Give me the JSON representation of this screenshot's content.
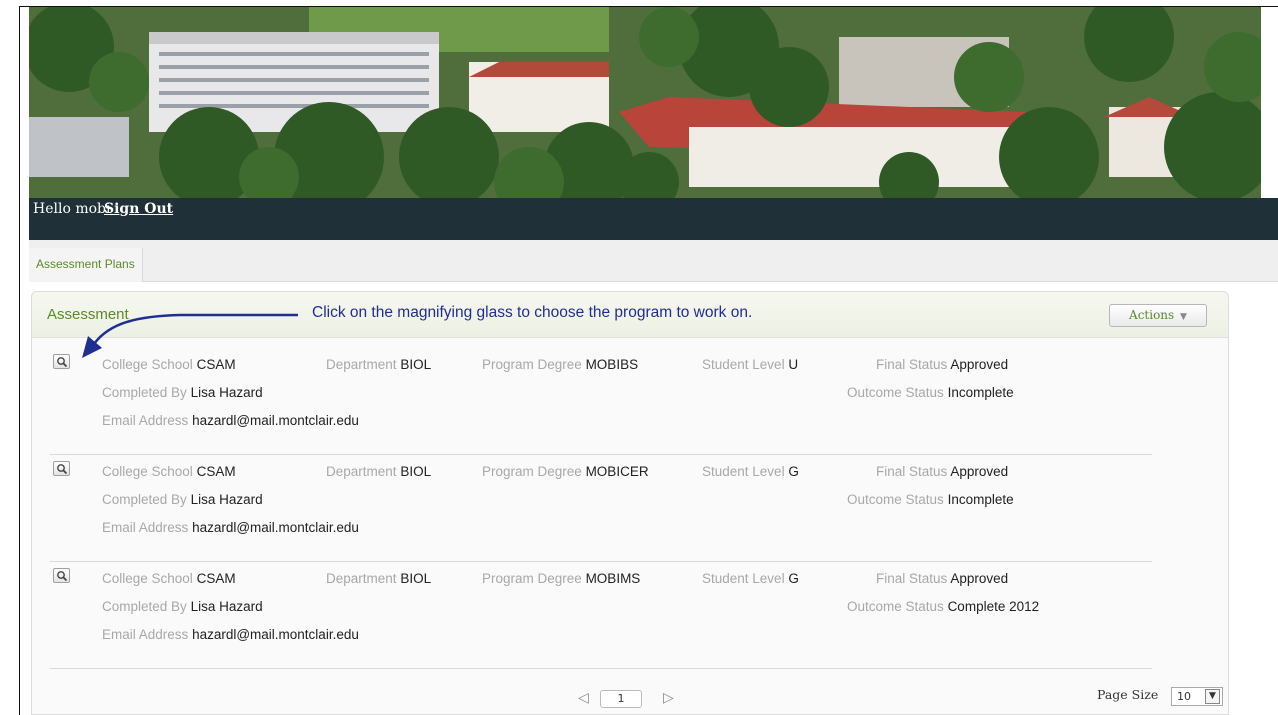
{
  "header": {
    "greeting": "Hello mobi",
    "sign_out": "Sign Out"
  },
  "tabs": [
    {
      "label": "Assessment Plans"
    }
  ],
  "panel": {
    "title": "Assessment",
    "annotation": "Click on the magnifying glass to choose the program to work on.",
    "actions_label": "Actions",
    "actions_caret": "▼"
  },
  "field_labels": {
    "college_school": "College School",
    "department": "Department",
    "program_degree": "Program Degree",
    "student_level": "Student Level",
    "final_status": "Final Status",
    "completed_by": "Completed By",
    "outcome_status": "Outcome Status",
    "email_address": "Email Address"
  },
  "records": [
    {
      "college_school": "CSAM",
      "department": "BIOL",
      "program_degree": "MOBIBS",
      "student_level": "U",
      "final_status": "Approved",
      "completed_by": "Lisa Hazard",
      "outcome_status": "Incomplete",
      "email_address": "hazardl@mail.montclair.edu"
    },
    {
      "college_school": "CSAM",
      "department": "BIOL",
      "program_degree": "MOBICER",
      "student_level": "G",
      "final_status": "Approved",
      "completed_by": "Lisa Hazard",
      "outcome_status": "Incomplete",
      "email_address": "hazardl@mail.montclair.edu"
    },
    {
      "college_school": "CSAM",
      "department": "BIOL",
      "program_degree": "MOBIMS",
      "student_level": "G",
      "final_status": "Approved",
      "completed_by": "Lisa Hazard",
      "outcome_status": "Complete 2012",
      "email_address": "hazardl@mail.montclair.edu"
    }
  ],
  "pager": {
    "prev": "◁",
    "current_page": "1",
    "next": "▷",
    "page_size_label": "Page Size",
    "page_size": "10"
  },
  "colors": {
    "accent_green": "#5a8a2a",
    "annotation_blue": "#1f2f8f",
    "header_bar": "#1f3038"
  }
}
